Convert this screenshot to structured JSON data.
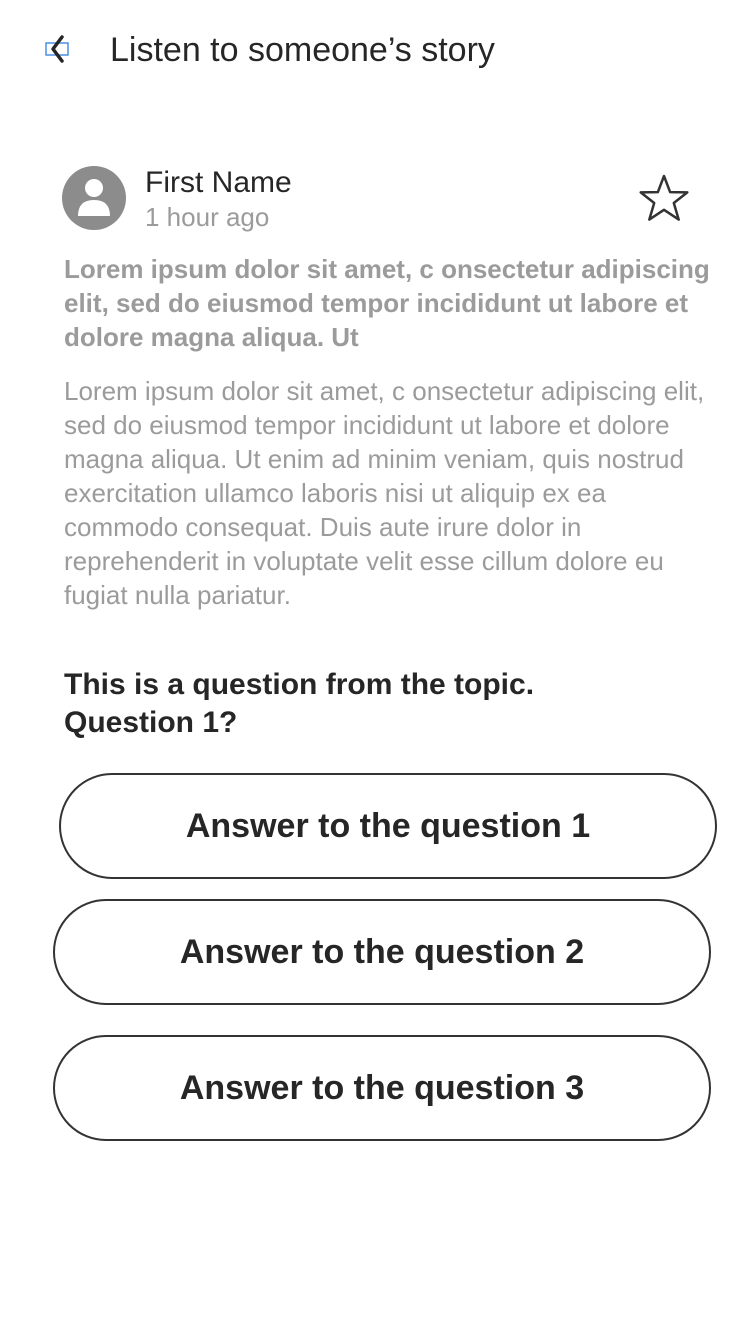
{
  "header": {
    "back_icon": "back-arrow-icon",
    "title": "Listen to someone’s story"
  },
  "post": {
    "avatar_icon": "user-avatar-icon",
    "author_name": "First Name",
    "time": "1 hour ago",
    "favorite_icon": "star-outline-icon",
    "lead": "Lorem ipsum dolor sit amet, c onsectetur adipiscing elit, sed do eiusmod tempor incididunt ut labore et dolore magna aliqua. Ut",
    "body": "Lorem ipsum dolor sit amet, c onsectetur adipiscing elit, sed do eiusmod tempor incididunt ut labore et dolore magna aliqua. Ut enim ad minim veniam, quis nostrud exercitation ullamco laboris nisi ut aliquip ex ea commodo consequat. Duis aute irure dolor in reprehenderit in voluptate velit esse cillum dolore eu fugiat nulla pariatur."
  },
  "question": {
    "text": "This is a question from the topic. Question 1?",
    "answers": [
      {
        "label": "Answer to the question 1"
      },
      {
        "label": "Answer to the question 2"
      },
      {
        "label": "Answer to the question 3"
      }
    ]
  },
  "colors": {
    "text_dark": "#262626",
    "text_muted": "#9b9b9b",
    "avatar_gray": "#8c8c8c",
    "back_icon_blue": "#4a90e2",
    "button_border": "#333333"
  }
}
